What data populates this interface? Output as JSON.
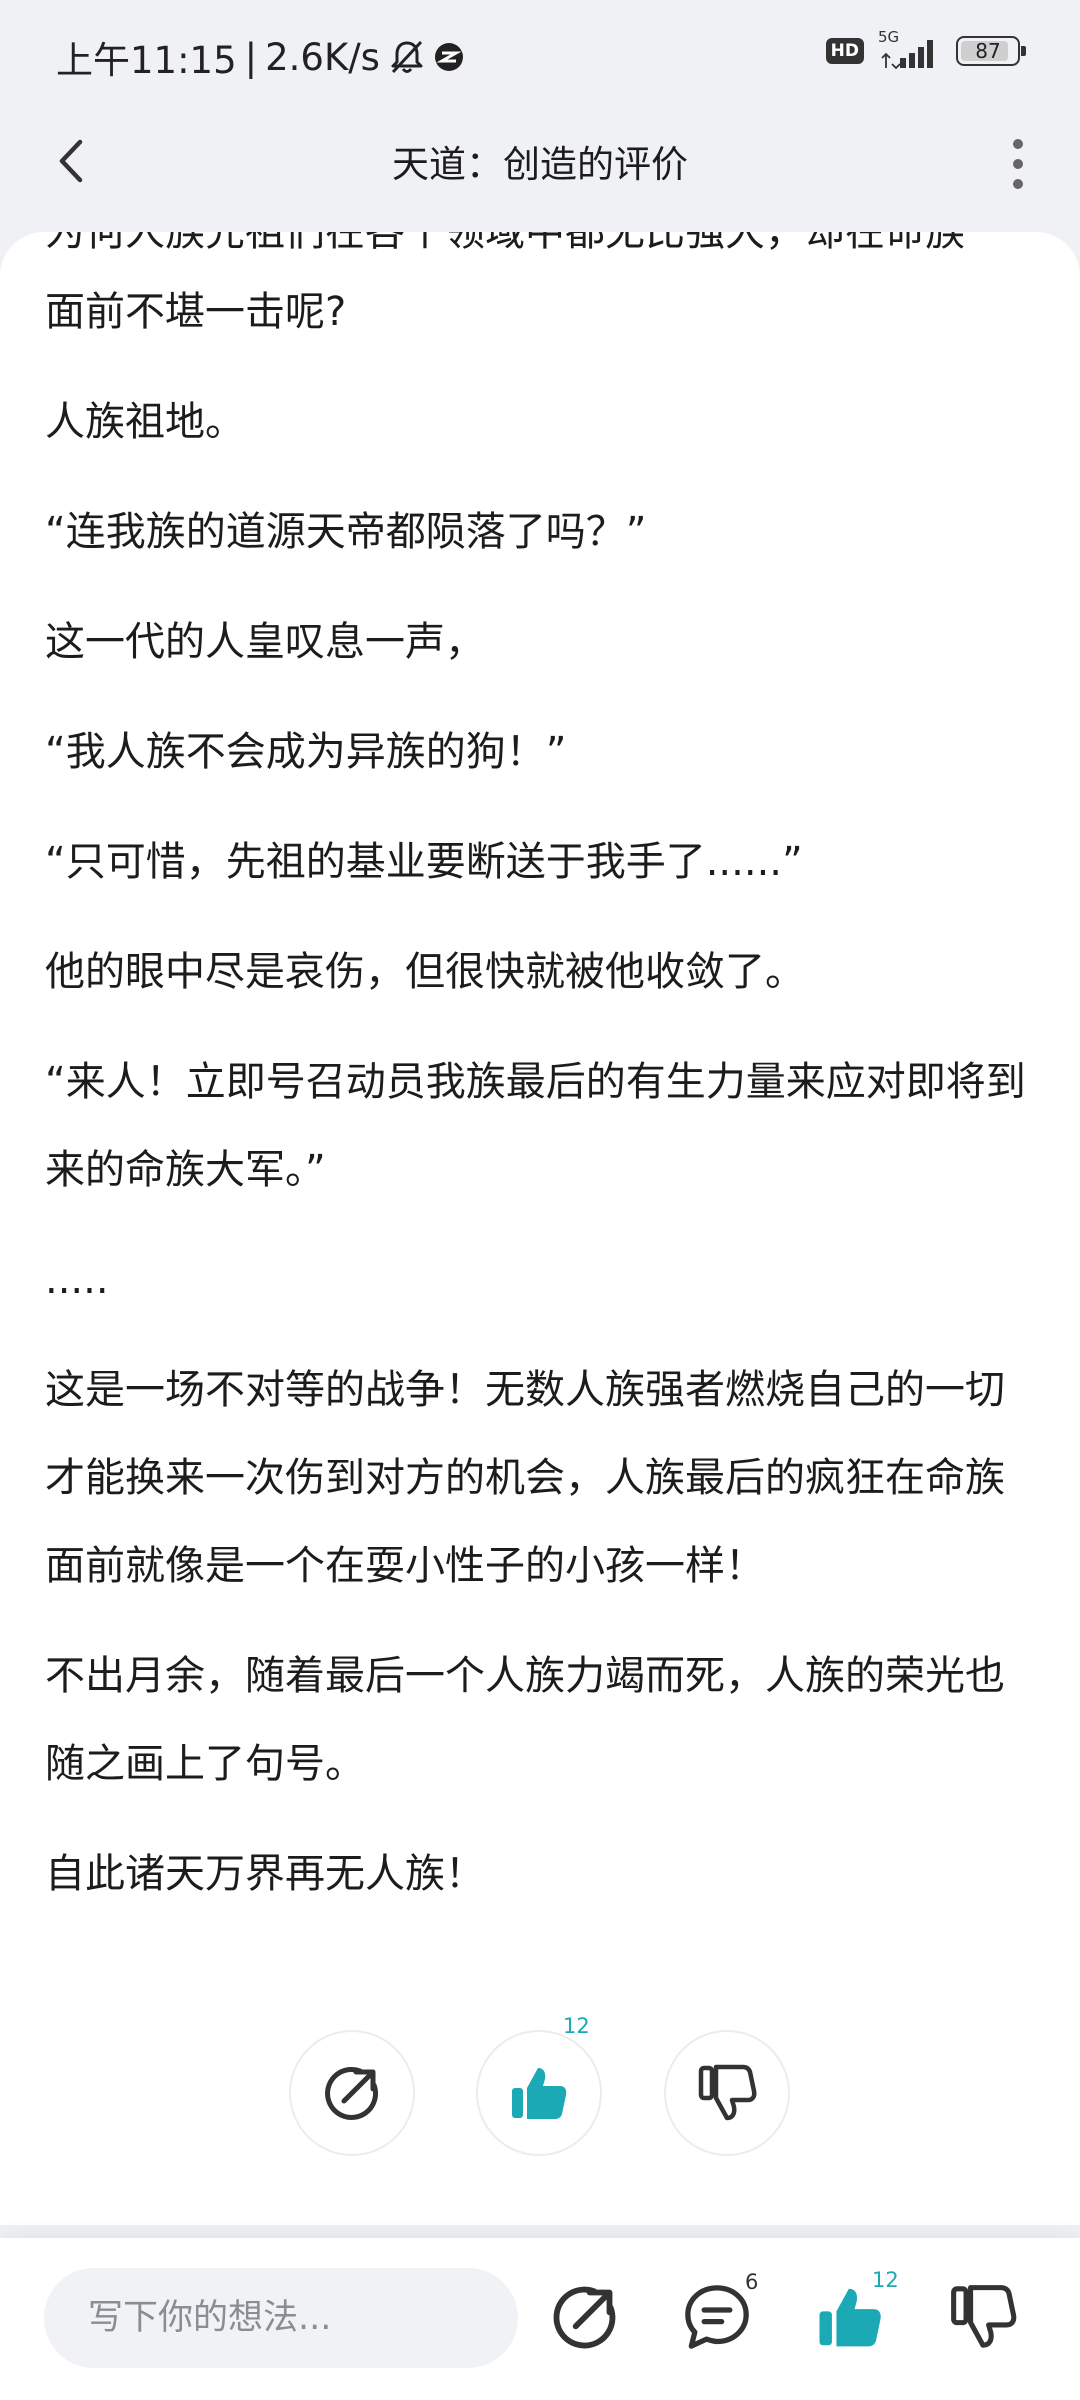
{
  "status_bar": {
    "time": "上午11:15",
    "separator": "|",
    "speed": "2.6K/s",
    "hd": "HD",
    "network": "5G",
    "battery": "87",
    "battery_level": 0.87
  },
  "header": {
    "title": "天道：创造的评价"
  },
  "content": {
    "partial_line": "为何人族先祖们在各个领域中都无比强大，却在命族",
    "paragraphs": [
      "面前不堪一击呢?",
      "人族祖地。",
      "“连我族的道源天帝都陨落了吗？”",
      "这一代的人皇叹息一声，",
      "“我人族不会成为异族的狗！”",
      "“只可惜，先祖的基业要断送于我手了......”",
      "他的眼中尽是哀伤，但很快就被他收敛了。",
      "“来人！立即号召动员我族最后的有生力量来应对即将到来的命族大军。”",
      ".....",
      "这是一场不对等的战争！无数人族强者燃烧自己的一切才能换来一次伤到对方的机会，人族最后的疯狂在命族面前就像是一个在耍小性子的小孩一样！",
      "不出月余，随着最后一个人族力竭而死，人族的荣光也随之画上了句号。",
      "自此诸天万界再无人族！"
    ]
  },
  "actions": {
    "like_count": "12"
  },
  "bottom_bar": {
    "input_placeholder": "写下你的想法...",
    "comment_count": "6",
    "like_count": "12"
  },
  "colors": {
    "accent": "#1aa9b5",
    "icon_gray": "#333333",
    "background": "#eff1f5"
  },
  "icons": [
    "notification-off-icon",
    "tiktok-icon",
    "signal-icon",
    "battery-icon",
    "back-arrow-icon",
    "more-vertical-icon",
    "share-icon",
    "thumbs-up-icon",
    "thumbs-down-icon",
    "comment-icon"
  ]
}
